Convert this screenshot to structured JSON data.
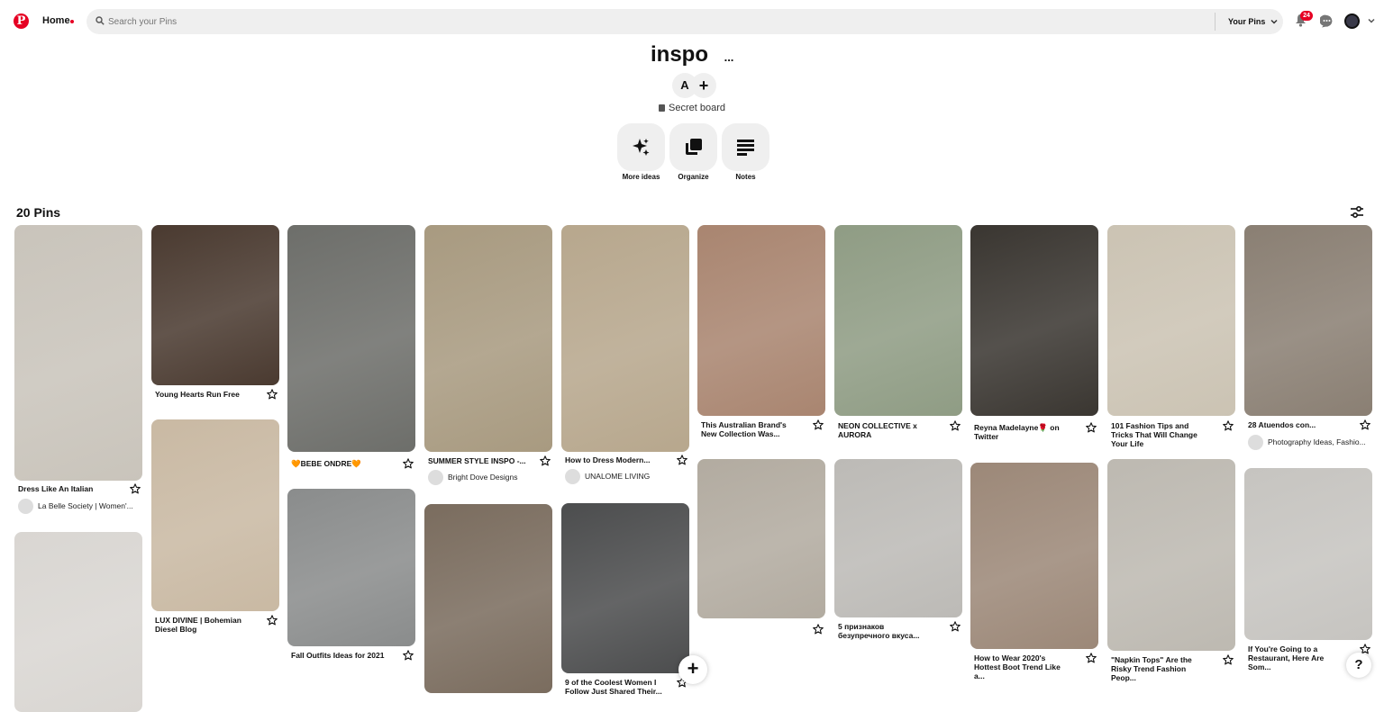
{
  "header": {
    "logo_letter": "P",
    "home_label": "Home",
    "search_placeholder": "Search your Pins",
    "your_pins_label": "Your Pins",
    "notification_count": "24"
  },
  "board": {
    "title": "inspo",
    "more_label": "...",
    "collaborator_initial": "A",
    "add_collaborator_label": "+",
    "secret_label": "Secret board"
  },
  "tools": [
    {
      "label": "More ideas"
    },
    {
      "label": "Organize"
    },
    {
      "label": "Notes"
    }
  ],
  "pin_count_label": "20 Pins",
  "pins": [
    {
      "title": "Dress Like An Italian",
      "source": "La Belle Society | Women'...",
      "color": "#c9c4bb"
    },
    {
      "title": "",
      "source": "",
      "color": "#d9d6d2"
    },
    {
      "title": "Young Hearts Run Free",
      "source": "",
      "color": "#4a3a30"
    },
    {
      "title": "LUX DIVINE | Bohemian Diesel Blog",
      "source": "",
      "color": "#c9b9a3"
    },
    {
      "title": "🧡BEBE ONDRE🧡",
      "source": "",
      "color": "#6d6e6a"
    },
    {
      "title": "Fall Outfits Ideas for 2021",
      "source": "",
      "color": "#8a8c8c"
    },
    {
      "title": "SUMMER STYLE INSPO -...",
      "source": "Bright Dove Designs",
      "color": "#a89a80"
    },
    {
      "title": "",
      "source": "",
      "color": "#7a6c5e"
    },
    {
      "title": "How to Dress Modern...",
      "source": "UNALOME LIVING",
      "color": "#b7a78d"
    },
    {
      "title": "9 of the Coolest Women I Follow Just Shared Their...",
      "source": "",
      "color": "#4c4d4e"
    },
    {
      "title": "This Australian Brand's New Collection Was...",
      "source": "",
      "color": "#a98570"
    },
    {
      "title": "",
      "source": "",
      "color": "#b2aba0"
    },
    {
      "title": "NEON COLLECTIVE x AURORA",
      "source": "",
      "color": "#8f9c84"
    },
    {
      "title": "5 признаков безупречного вкуса...",
      "source": "",
      "color": "#bcbab6"
    },
    {
      "title": "Reyna Madelayne🌹 on Twitter",
      "source": "",
      "color": "#3a3631"
    },
    {
      "title": "How to Wear 2020's Hottest Boot Trend Like a...",
      "source": "",
      "color": "#9c8878"
    },
    {
      "title": "101 Fashion Tips and Tricks That Will Change Your Life",
      "source": "",
      "color": "#cbc3b3"
    },
    {
      "title": "\"Napkin Tops\" Are the Risky Trend Fashion Peop...",
      "source": "",
      "color": "#bdb9b1"
    },
    {
      "title": "28 Atuendos con...",
      "source": "Photography Ideas, Fashio...",
      "color": "#8a7f73"
    },
    {
      "title": "If You're Going to a Restaurant, Here Are Som...",
      "source": "",
      "color": "#c6c4c0"
    }
  ],
  "fab_label": "+",
  "help_label": "?"
}
